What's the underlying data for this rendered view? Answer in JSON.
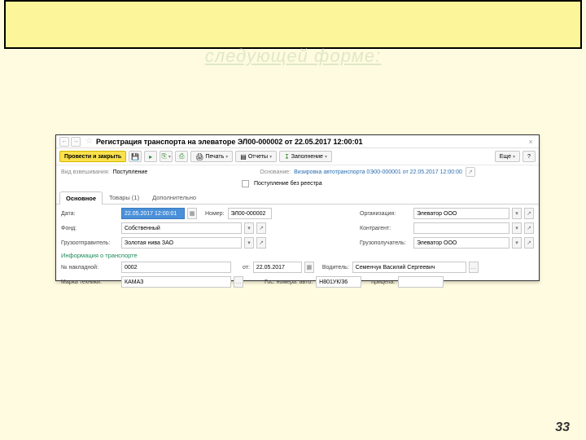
{
  "ghost_title": "следующей форме:",
  "titlebar": {
    "text": "Регистрация транспорта на элеваторе ЭЛ00-000002 от 22.05.2017 12:00:01"
  },
  "toolbar": {
    "post_and_close": "Провести и закрыть",
    "print": "Печать",
    "reports": "Отчеты",
    "fill": "Заполнение",
    "more": "Еще",
    "help": "?"
  },
  "info": {
    "type_label": "Вид взвешивания:",
    "type_value": "Поступление",
    "basis_label": "Основание:",
    "basis_value": "Визировка автотранспорта 0Э00-000001 от 22.05.2017 12:00:00",
    "no_registry": "Поступление без реестра"
  },
  "tabs": {
    "main": "Основное",
    "goods": "Товары (1)",
    "additional": "Дополнительно"
  },
  "form": {
    "date_label": "Дата:",
    "date_value": "22.05.2017 12:00:01",
    "number_label": "Номер:",
    "number_value": "ЭЛ00-000002",
    "org_label": "Организация:",
    "org_value": "Элеватор ООО",
    "fund_label": "Фонд:",
    "fund_value": "Собственный",
    "counterparty_label": "Контрагент:",
    "sender_label": "Грузоотправитель:",
    "sender_value": "Золотая нива ЗАО",
    "receiver_label": "Грузополучатель:",
    "receiver_value": "Элеватор ООО",
    "transport_section": "Информация о транспорте",
    "waybill_label": "№ накладной:",
    "waybill_value": "0002",
    "waybill_date_label": "от:",
    "waybill_date": "22.05.2017",
    "driver_label": "Водитель:",
    "driver_value": "Семенчук Василий Сергеевич",
    "vehicle_label": "Марка техники:",
    "vehicle_value": "КАМАЗ",
    "plate_label": "Гос. номера: авто:",
    "plate_value": "Н801УК/36",
    "trailer_label": "прицепа:"
  },
  "page_number": "33"
}
